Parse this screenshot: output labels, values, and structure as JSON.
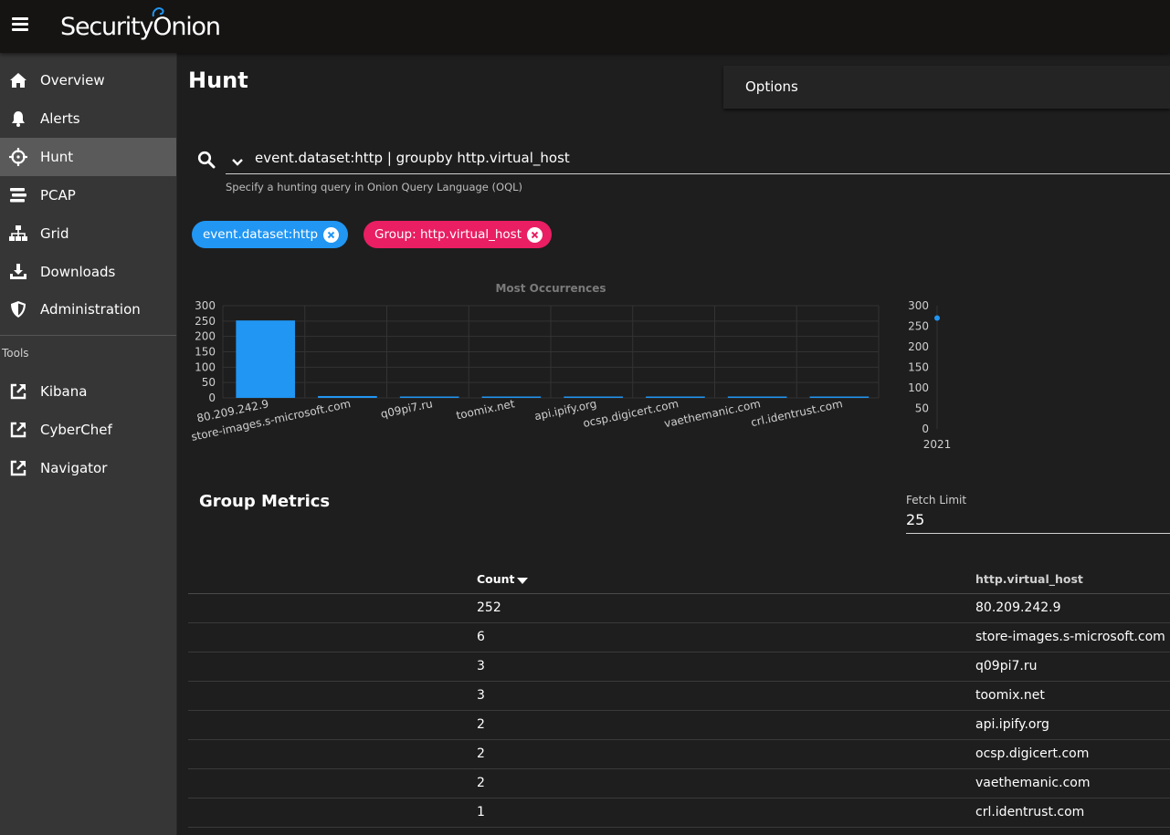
{
  "app": {
    "brand": "Security",
    "brand_o": "O",
    "brand_rest": "nion"
  },
  "sidebar": {
    "items": [
      {
        "label": "Overview",
        "icon": "home-icon"
      },
      {
        "label": "Alerts",
        "icon": "bell-icon"
      },
      {
        "label": "Hunt",
        "icon": "crosshairs-icon",
        "active": true
      },
      {
        "label": "PCAP",
        "icon": "stream-icon"
      },
      {
        "label": "Grid",
        "icon": "sitemap-icon"
      },
      {
        "label": "Downloads",
        "icon": "download-icon"
      },
      {
        "label": "Administration",
        "icon": "shield-icon"
      }
    ],
    "tools_label": "Tools",
    "tools": [
      {
        "label": "Kibana",
        "icon": "external-link-icon"
      },
      {
        "label": "CyberChef",
        "icon": "external-link-icon"
      },
      {
        "label": "Navigator",
        "icon": "external-link-icon"
      }
    ]
  },
  "main": {
    "title": "Hunt",
    "options_label": "Options",
    "query": "event.dataset:http | groupby http.virtual_host",
    "query_hint": "Specify a hunting query in Onion Query Language (OQL)",
    "chips": [
      {
        "label": "event.dataset:http",
        "color": "#2196f3"
      },
      {
        "label": "Group: http.virtual_host",
        "color": "#e91e63"
      }
    ]
  },
  "chart_data": [
    {
      "type": "bar",
      "title": "Most Occurrences",
      "categories": [
        "80.209.242.9",
        "store-images.s-microsoft.com",
        "q09pi7.ru",
        "toomix.net",
        "api.ipify.org",
        "ocsp.digicert.com",
        "vaethemanic.com",
        "crl.identrust.com"
      ],
      "values": [
        252,
        6,
        3,
        3,
        2,
        2,
        2,
        1
      ],
      "ylim": [
        0,
        300
      ],
      "yticks": [
        0,
        50,
        100,
        150,
        200,
        250,
        300
      ],
      "color": "#2196f3"
    },
    {
      "type": "scatter",
      "x": [
        "2021"
      ],
      "values": [
        270
      ],
      "ylim": [
        0,
        300
      ],
      "yticks": [
        0,
        50,
        100,
        150,
        200,
        250,
        300
      ],
      "xtick": "2021",
      "color": "#2196f3"
    }
  ],
  "metrics": {
    "title": "Group Metrics",
    "fetch_limit_label": "Fetch Limit",
    "fetch_limit": "25",
    "columns": [
      "Count",
      "http.virtual_host"
    ],
    "rows": [
      {
        "count": "252",
        "host": "80.209.242.9"
      },
      {
        "count": "6",
        "host": "store-images.s-microsoft.com"
      },
      {
        "count": "3",
        "host": "q09pi7.ru"
      },
      {
        "count": "3",
        "host": "toomix.net"
      },
      {
        "count": "2",
        "host": "api.ipify.org"
      },
      {
        "count": "2",
        "host": "ocsp.digicert.com"
      },
      {
        "count": "2",
        "host": "vaethemanic.com"
      },
      {
        "count": "1",
        "host": "crl.identrust.com"
      }
    ]
  }
}
